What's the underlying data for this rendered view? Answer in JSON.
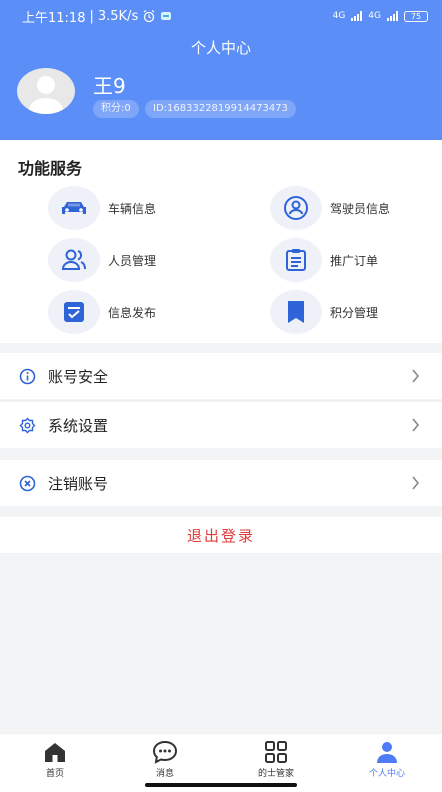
{
  "status_bar": {
    "time": "上午11:18",
    "speed": "3.5K/s",
    "network": "4G",
    "battery": "75"
  },
  "header": {
    "title": "个人中心",
    "username": "王9",
    "points": "积分:0",
    "user_id": "ID:1683322819914473473"
  },
  "services": {
    "title": "功能服务",
    "items": [
      {
        "label": "车辆信息",
        "icon": "car-icon"
      },
      {
        "label": "驾驶员信息",
        "icon": "driver-icon"
      },
      {
        "label": "人员管理",
        "icon": "people-icon"
      },
      {
        "label": "推广订单",
        "icon": "clipboard-icon"
      },
      {
        "label": "信息发布",
        "icon": "publish-icon"
      },
      {
        "label": "积分管理",
        "icon": "bookmark-icon"
      }
    ]
  },
  "menu": {
    "account_security": "账号安全",
    "system_settings": "系统设置",
    "cancel_account": "注销账号",
    "logout": "退出登录"
  },
  "tabbar": {
    "tabs": [
      {
        "label": "首页",
        "icon": "home-icon"
      },
      {
        "label": "消息",
        "icon": "message-icon"
      },
      {
        "label": "的士管家",
        "icon": "grid-icon"
      },
      {
        "label": "个人中心",
        "icon": "user-icon"
      }
    ],
    "active_index": 3
  },
  "colors": {
    "header_bg": "#5b8ef6",
    "accent": "#4f7cf6",
    "icon_blue": "#2f63d8",
    "logout_red": "#e03a3a"
  }
}
